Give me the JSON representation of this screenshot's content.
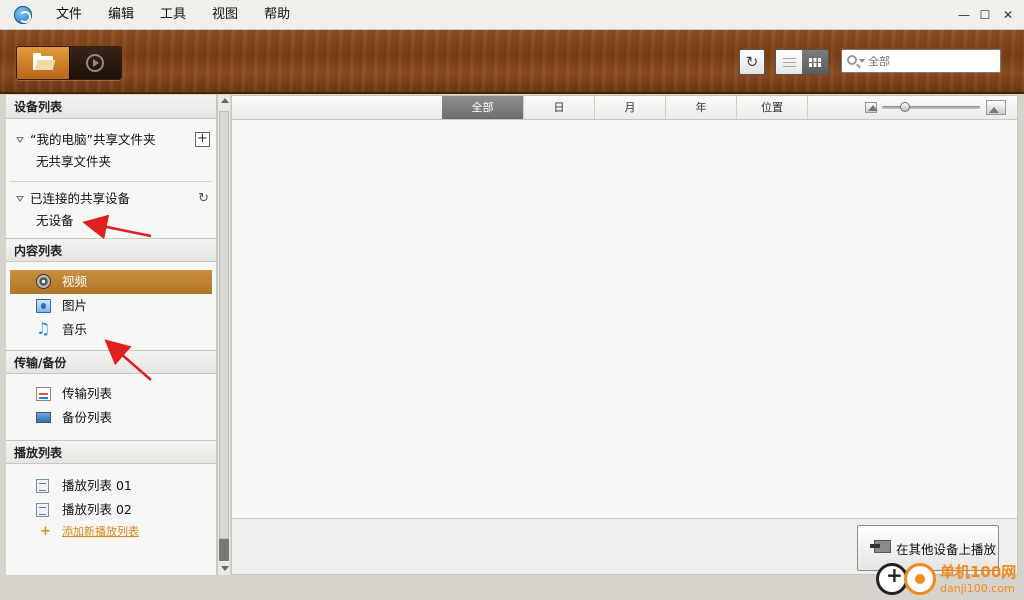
{
  "menu": [
    "文件",
    "编辑",
    "工具",
    "视图",
    "帮助"
  ],
  "window_controls": {
    "minimize": "—",
    "maximize": "☐",
    "close": "✕"
  },
  "toolbar": {
    "refresh_glyph": "↻",
    "search": {
      "value": "",
      "placeholder": "全部"
    }
  },
  "sidebar": {
    "devices": {
      "header": "设备列表",
      "my_pc_share": {
        "label": "“我的电脑”共享文件夹",
        "child": "无共享文件夹",
        "add_glyph": "+"
      },
      "connected": {
        "label": "已连接的共享设备",
        "child": "无设备",
        "refresh_glyph": "↻"
      }
    },
    "content": {
      "header": "内容列表",
      "items": [
        {
          "label": "视频",
          "icon": "film-reel-icon",
          "selected": true
        },
        {
          "label": "图片",
          "icon": "photo-icon",
          "selected": false
        },
        {
          "label": "音乐",
          "icon": "music-note-icon",
          "selected": false
        }
      ]
    },
    "transfer": {
      "header": "传输/备份",
      "items": [
        {
          "label": "传输列表",
          "icon": "transfer-icon"
        },
        {
          "label": "备份列表",
          "icon": "backup-icon"
        }
      ]
    },
    "playlists": {
      "header": "播放列表",
      "items": [
        {
          "label": "播放列表 01",
          "icon": "playlist-icon"
        },
        {
          "label": "播放列表 02",
          "icon": "playlist-icon"
        }
      ],
      "add_label": "添加新播放列表"
    }
  },
  "main": {
    "tabs": [
      {
        "label": "全部",
        "active": true
      },
      {
        "label": "日",
        "active": false
      },
      {
        "label": "月",
        "active": false
      },
      {
        "label": "年",
        "active": false
      },
      {
        "label": "位置",
        "active": false
      }
    ],
    "zoom_level": 0.2,
    "play_on_other_device": "在其他设备上播放"
  },
  "watermark": {
    "title": "单机100网",
    "url": "danji100.com"
  },
  "colors": {
    "selected_item": "#b07425",
    "annotation_arrow": "#e02020",
    "watermark": "#f08a1c"
  }
}
